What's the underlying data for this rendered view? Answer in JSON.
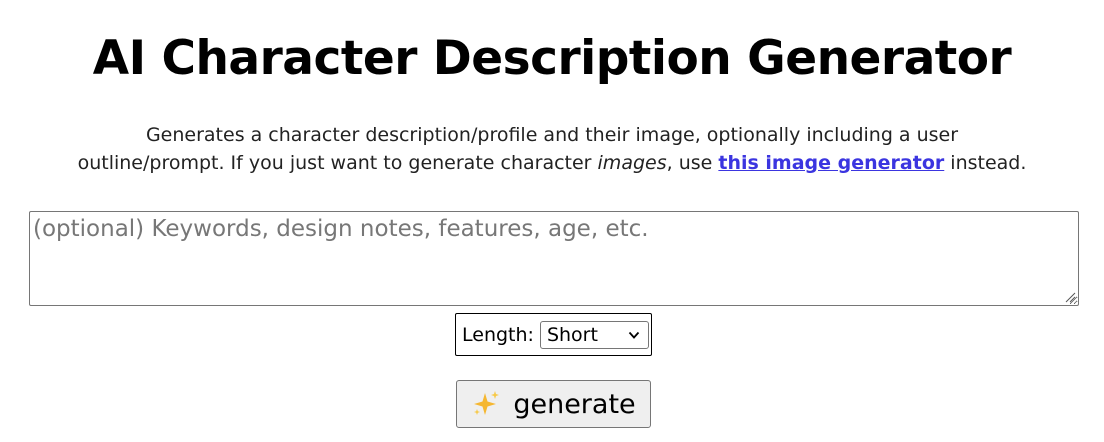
{
  "header": {
    "title": "AI Character Description Generator"
  },
  "description": {
    "line1": "Generates a character description/profile and their image, optionally including a user",
    "line2_before": "outline/prompt. If you just want to generate character ",
    "line2_italic": "images",
    "line2_middle": ", use ",
    "link_text": "this image generator",
    "line2_after": " instead."
  },
  "prompt": {
    "placeholder": "(optional) Keywords, design notes, features, age, etc.",
    "value": ""
  },
  "length": {
    "label": "Length:",
    "selected": "Short"
  },
  "generate": {
    "icon": "sparkles-icon",
    "label": "generate"
  },
  "colors": {
    "link": "#3b35e0",
    "sparkle": "#f5b731"
  }
}
